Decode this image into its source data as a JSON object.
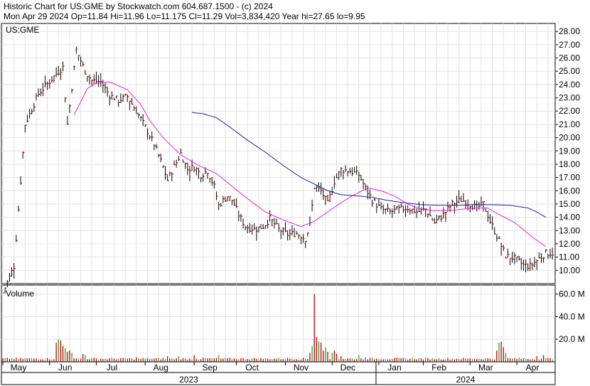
{
  "header": {
    "line1": "Historic Chart for US:GME by Stockwatch.com 604.687.1500 - (c) 2024",
    "line2": "Mon Apr 29 2024  Op=11.84  Hi=11.96  Lo=11.175  Cl=11.29  Vol=3,834,420  Year hi=27.65  lo=9.95"
  },
  "chart_data": [
    {
      "type": "ohlc",
      "symbol_label": "US:GME",
      "y_ticks": [
        "10.00",
        "11.00",
        "12.00",
        "13.00",
        "14.00",
        "15.00",
        "16.00",
        "17.00",
        "18.00",
        "19.00",
        "20.00",
        "21.00",
        "22.00",
        "23.00",
        "24.00",
        "25.00",
        "26.00",
        "27.00",
        "28.00"
      ],
      "ylim": [
        9.0,
        28.6
      ],
      "months": [
        "May",
        "Jun",
        "Jul",
        "Aug",
        "Sep",
        "Oct",
        "Nov",
        "Dec",
        "Jan",
        "Feb",
        "Mar",
        "Apr"
      ],
      "years": [
        "2023",
        "2024"
      ],
      "anchors": [
        [
          0,
          8.3
        ],
        [
          5,
          10.3
        ],
        [
          10,
          21.0
        ],
        [
          16,
          23.3
        ],
        [
          24,
          24.8
        ],
        [
          27,
          25.3
        ],
        [
          29,
          21.0
        ],
        [
          33,
          26.6
        ],
        [
          37,
          25.0
        ],
        [
          40,
          24.3
        ],
        [
          44,
          24.2
        ],
        [
          48,
          23.2
        ],
        [
          52,
          22.8
        ],
        [
          56,
          23.1
        ],
        [
          60,
          22.0
        ],
        [
          64,
          20.8
        ],
        [
          68,
          19.5
        ],
        [
          72,
          17.8
        ],
        [
          74,
          16.8
        ],
        [
          77,
          17.8
        ],
        [
          80,
          18.8
        ],
        [
          83,
          17.6
        ],
        [
          86,
          17.8
        ],
        [
          89,
          17.2
        ],
        [
          92,
          17.5
        ],
        [
          95,
          16.3
        ],
        [
          97,
          14.9
        ],
        [
          101,
          15.6
        ],
        [
          103,
          15.3
        ],
        [
          106,
          14.2
        ],
        [
          109,
          13.3
        ],
        [
          113,
          13.1
        ],
        [
          117,
          13.3
        ],
        [
          120,
          13.9
        ],
        [
          124,
          13.1
        ],
        [
          128,
          12.7
        ],
        [
          132,
          12.8
        ],
        [
          136,
          12.4
        ],
        [
          138,
          13.4
        ],
        [
          140,
          16.3
        ],
        [
          143,
          16.0
        ],
        [
          146,
          15.0
        ],
        [
          149,
          16.7
        ],
        [
          152,
          17.6
        ],
        [
          156,
          17.5
        ],
        [
          160,
          17.2
        ],
        [
          163,
          16.2
        ],
        [
          166,
          15.3
        ],
        [
          170,
          14.6
        ],
        [
          174,
          14.4
        ],
        [
          178,
          14.6
        ],
        [
          182,
          14.7
        ],
        [
          186,
          14.4
        ],
        [
          190,
          14.6
        ],
        [
          194,
          13.6
        ],
        [
          198,
          14.2
        ],
        [
          202,
          15.0
        ],
        [
          206,
          15.3
        ],
        [
          210,
          15.0
        ],
        [
          213,
          14.7
        ],
        [
          216,
          15.0
        ],
        [
          219,
          13.7
        ],
        [
          222,
          12.6
        ],
        [
          226,
          11.1
        ],
        [
          230,
          10.9
        ],
        [
          234,
          10.4
        ],
        [
          237,
          10.3
        ],
        [
          241,
          10.9
        ],
        [
          244,
          11.3
        ]
      ],
      "ma_short_color": "#e020e0",
      "ma_short_anchors": [
        [
          32,
          21.7
        ],
        [
          38,
          23.7
        ],
        [
          42,
          24.1
        ],
        [
          48,
          24.2
        ],
        [
          56,
          23.6
        ],
        [
          62,
          22.5
        ],
        [
          66,
          21.3
        ],
        [
          72,
          20.0
        ],
        [
          80,
          18.7
        ],
        [
          88,
          17.9
        ],
        [
          96,
          17.3
        ],
        [
          104,
          16.2
        ],
        [
          110,
          15.4
        ],
        [
          118,
          14.4
        ],
        [
          126,
          13.8
        ],
        [
          134,
          13.3
        ],
        [
          140,
          13.7
        ],
        [
          146,
          14.4
        ],
        [
          152,
          15.1
        ],
        [
          158,
          15.7
        ],
        [
          164,
          16.2
        ],
        [
          170,
          16.0
        ],
        [
          176,
          15.6
        ],
        [
          182,
          15.0
        ],
        [
          188,
          14.6
        ],
        [
          194,
          14.5
        ],
        [
          200,
          14.5
        ],
        [
          206,
          14.6
        ],
        [
          212,
          14.7
        ],
        [
          218,
          14.7
        ],
        [
          222,
          14.3
        ],
        [
          230,
          13.6
        ],
        [
          238,
          12.5
        ],
        [
          244,
          11.8
        ]
      ],
      "ma_long_color": "#1f1fa8",
      "ma_long_anchors": [
        [
          85,
          21.9
        ],
        [
          90,
          21.8
        ],
        [
          96,
          21.5
        ],
        [
          102,
          20.8
        ],
        [
          110,
          19.8
        ],
        [
          118,
          18.9
        ],
        [
          126,
          17.9
        ],
        [
          134,
          17.0
        ],
        [
          140,
          16.5
        ],
        [
          146,
          16.0
        ],
        [
          152,
          15.7
        ],
        [
          160,
          15.6
        ],
        [
          166,
          15.5
        ],
        [
          172,
          15.3
        ],
        [
          180,
          15.1
        ],
        [
          188,
          14.95
        ],
        [
          196,
          14.9
        ],
        [
          204,
          14.9
        ],
        [
          212,
          14.95
        ],
        [
          220,
          14.95
        ],
        [
          228,
          14.9
        ],
        [
          236,
          14.7
        ],
        [
          240,
          14.4
        ],
        [
          244,
          14.0
        ]
      ]
    },
    {
      "type": "bar",
      "title": "Volume",
      "y_ticks": [
        "20.0 M",
        "40.0 M",
        "60.0 M"
      ],
      "ylim": [
        0,
        68
      ],
      "base_volume": 2.8,
      "spikes": [
        [
          24,
          17
        ],
        [
          25,
          20
        ],
        [
          26,
          19
        ],
        [
          27,
          14
        ],
        [
          28,
          12
        ],
        [
          29,
          9
        ],
        [
          30,
          10
        ],
        [
          31,
          8
        ],
        [
          36,
          7
        ],
        [
          37,
          6
        ],
        [
          60,
          4
        ],
        [
          74,
          5
        ],
        [
          79,
          5
        ],
        [
          86,
          6
        ],
        [
          97,
          6
        ],
        [
          138,
          8
        ],
        [
          139,
          14
        ],
        [
          140,
          60
        ],
        [
          141,
          22
        ],
        [
          142,
          18
        ],
        [
          143,
          17
        ],
        [
          144,
          10
        ],
        [
          145,
          13
        ],
        [
          146,
          9
        ],
        [
          148,
          8
        ],
        [
          149,
          10
        ],
        [
          150,
          7
        ],
        [
          152,
          5
        ],
        [
          160,
          6
        ],
        [
          163,
          4
        ],
        [
          222,
          10
        ],
        [
          223,
          17
        ],
        [
          224,
          18
        ],
        [
          225,
          13
        ],
        [
          226,
          8
        ],
        [
          240,
          5
        ],
        [
          243,
          6
        ]
      ]
    }
  ]
}
